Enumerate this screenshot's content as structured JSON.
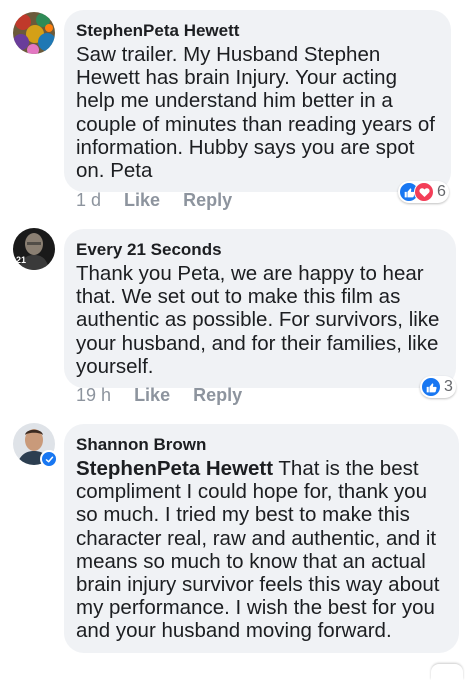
{
  "comments": [
    {
      "author": "StephenPeta Hewett",
      "text": "Saw trailer. My Husband Stephen Hewett has brain Injury. Your acting help me understand him better in a couple of minutes than reading years of information. Hubby says you are spot on.  Peta",
      "time": "1 d",
      "like_label": "Like",
      "reply_label": "Reply",
      "reactions": [
        "like-icon",
        "love-icon"
      ],
      "reaction_count": "6",
      "avatar": "avatar-icon"
    },
    {
      "author": "Every 21 Seconds",
      "text": "Thank you Peta, we are happy to hear that. We set out to make this film as authentic as possible. For survivors, like your husband, and for their families, like yourself.",
      "time": "19 h",
      "like_label": "Like",
      "reply_label": "Reply",
      "reactions": [
        "like-icon"
      ],
      "reaction_count": "3",
      "avatar": "avatar-icon",
      "avatar_text": "21"
    },
    {
      "author": "Shannon Brown",
      "mention": "StephenPeta Hewett",
      "text": " That is the best compliment I could hope for, thank you so much. I tried my best to make this character real, raw and authentic, and it means so much to know that an actual brain injury survivor feels this way about my performance. I wish the best for you and your husband moving forward.",
      "avatar": "avatar-icon",
      "badge": "verified-badge-icon"
    }
  ],
  "colors": {
    "bubble": "#f0f2f5",
    "meta_text": "#8d949e",
    "like_blue": "#1877f2",
    "love_red": "#f33e58"
  }
}
